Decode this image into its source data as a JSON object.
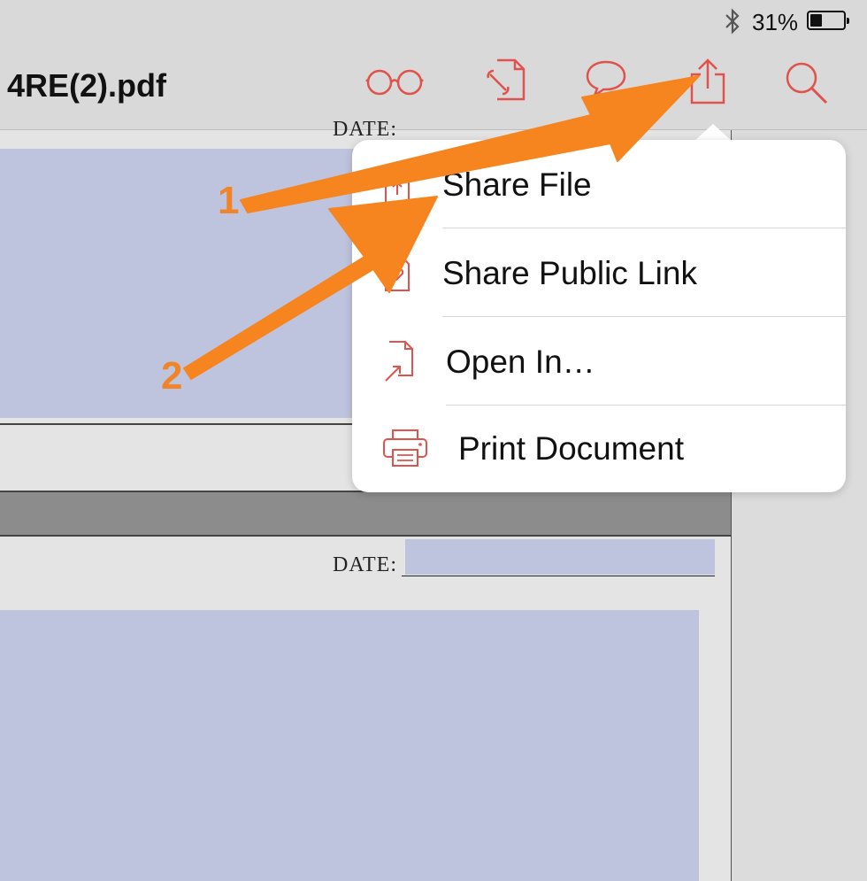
{
  "status_bar": {
    "battery_percent": "31%",
    "bluetooth_icon": "bluetooth-icon",
    "battery_level": 0.31
  },
  "toolbar": {
    "title": "4RE(2).pdf",
    "icons": [
      "reading-glasses-icon",
      "document-tools-icon",
      "comment-icon",
      "share-icon",
      "search-icon"
    ],
    "accent_color": "#e0524c"
  },
  "document": {
    "date_label_top": "DATE:",
    "date_label": "DATE:",
    "field_color": "#bfc4de"
  },
  "share_menu": {
    "items": [
      {
        "label": "Share File",
        "icon": "share-file-icon"
      },
      {
        "label": "Share Public Link",
        "icon": "public-link-icon"
      },
      {
        "label": "Open In…",
        "icon": "open-in-icon"
      },
      {
        "label": "Print Document",
        "icon": "printer-icon"
      }
    ]
  },
  "annotations": {
    "step1": "1",
    "step2": "2",
    "color": "#f08428"
  }
}
